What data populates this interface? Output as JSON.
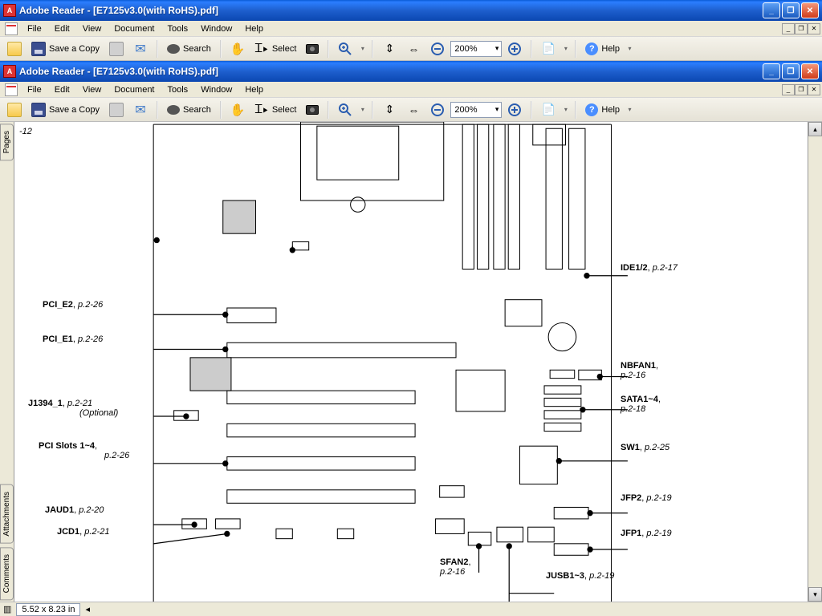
{
  "window1": {
    "title": "Adobe Reader - [E7125v3.0(with RoHS).pdf]",
    "app_abbrev": "A"
  },
  "window2": {
    "title": "Adobe Reader - [E7125v3.0(with RoHS).pdf]",
    "app_abbrev": "A"
  },
  "menus": [
    "File",
    "Edit",
    "View",
    "Document",
    "Tools",
    "Window",
    "Help"
  ],
  "toolbar": {
    "save_copy": "Save a Copy",
    "search": "Search",
    "select": "Select",
    "zoom_value": "200%",
    "help": "Help"
  },
  "side_tabs": [
    "Pages",
    "Attachments",
    "Comments"
  ],
  "statusbar": {
    "dimensions": "5.52 x 8.23 in"
  },
  "callouts": {
    "top_left_page": "-12",
    "pci_e2": {
      "name": "PCI_E2",
      "ref": "p.2-26"
    },
    "pci_e1": {
      "name": "PCI_E1",
      "ref": "p.2-26"
    },
    "j1394": {
      "name": "J1394_1",
      "ref": "p.2-21",
      "note": "(Optional)"
    },
    "pci_slots": {
      "name": "PCI Slots 1~4",
      "ref": "p.2-26"
    },
    "jaud1": {
      "name": "JAUD1",
      "ref": "p.2-20"
    },
    "jcd1": {
      "name": "JCD1",
      "ref": "p.2-21"
    },
    "sfan2": {
      "name": "SFAN2",
      "ref": "p.2-16"
    },
    "jusb": {
      "name": "JUSB1~3",
      "ref": "p.2-19"
    },
    "jfp1": {
      "name": "JFP1",
      "ref": "p.2-19"
    },
    "jfp2": {
      "name": "JFP2",
      "ref": "p.2-19"
    },
    "sw1": {
      "name": "SW1",
      "ref": "p.2-25"
    },
    "sata": {
      "name": "SATA1~4",
      "ref": "p.2-18"
    },
    "nbfan1": {
      "name": "NBFAN1",
      "ref": "p.2-16"
    },
    "ide": {
      "name": "IDE1/2",
      "ref": "p.2-17"
    }
  }
}
